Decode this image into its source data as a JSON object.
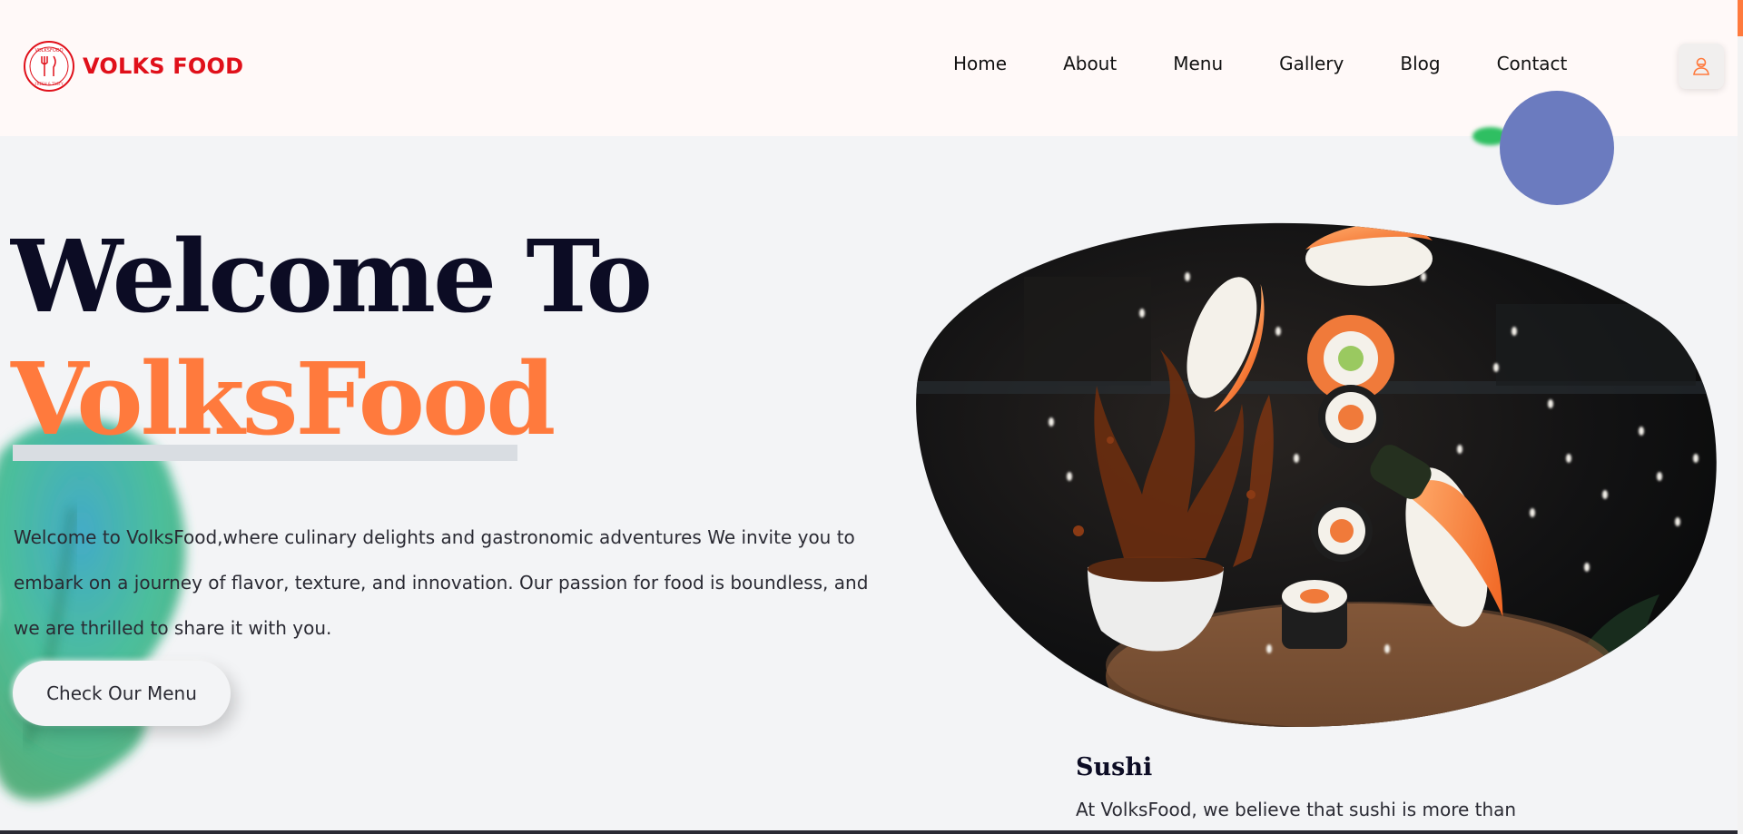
{
  "brand": {
    "name": "VOLKS FOOD",
    "logo_text_top": "VOLKSFOOD",
    "logo_text_bottom": "FRESH & TASTY",
    "color": "#e0101a"
  },
  "nav": {
    "items": [
      {
        "label": "Home"
      },
      {
        "label": "About"
      },
      {
        "label": "Menu"
      },
      {
        "label": "Gallery"
      },
      {
        "label": "Blog"
      },
      {
        "label": "Contact"
      }
    ]
  },
  "header": {
    "user_icon": "user-icon",
    "accent": "#ff7a3d"
  },
  "hero": {
    "title_line1": "Welcome To",
    "title_line2": "VolksFood",
    "description": "Welcome to VolksFood,where culinary delights and gastronomic adventures We invite you to embark on a journey of flavor, texture, and innovation. Our passion for food is boundless, and we are thrilled to share it with you.",
    "cta_label": "Check Our Menu",
    "title_color": "#0c0c24",
    "highlight_color": "#ff7a3d"
  },
  "featured": {
    "title": "Sushi",
    "description": "At VolksFood, we believe that sushi is more than"
  }
}
